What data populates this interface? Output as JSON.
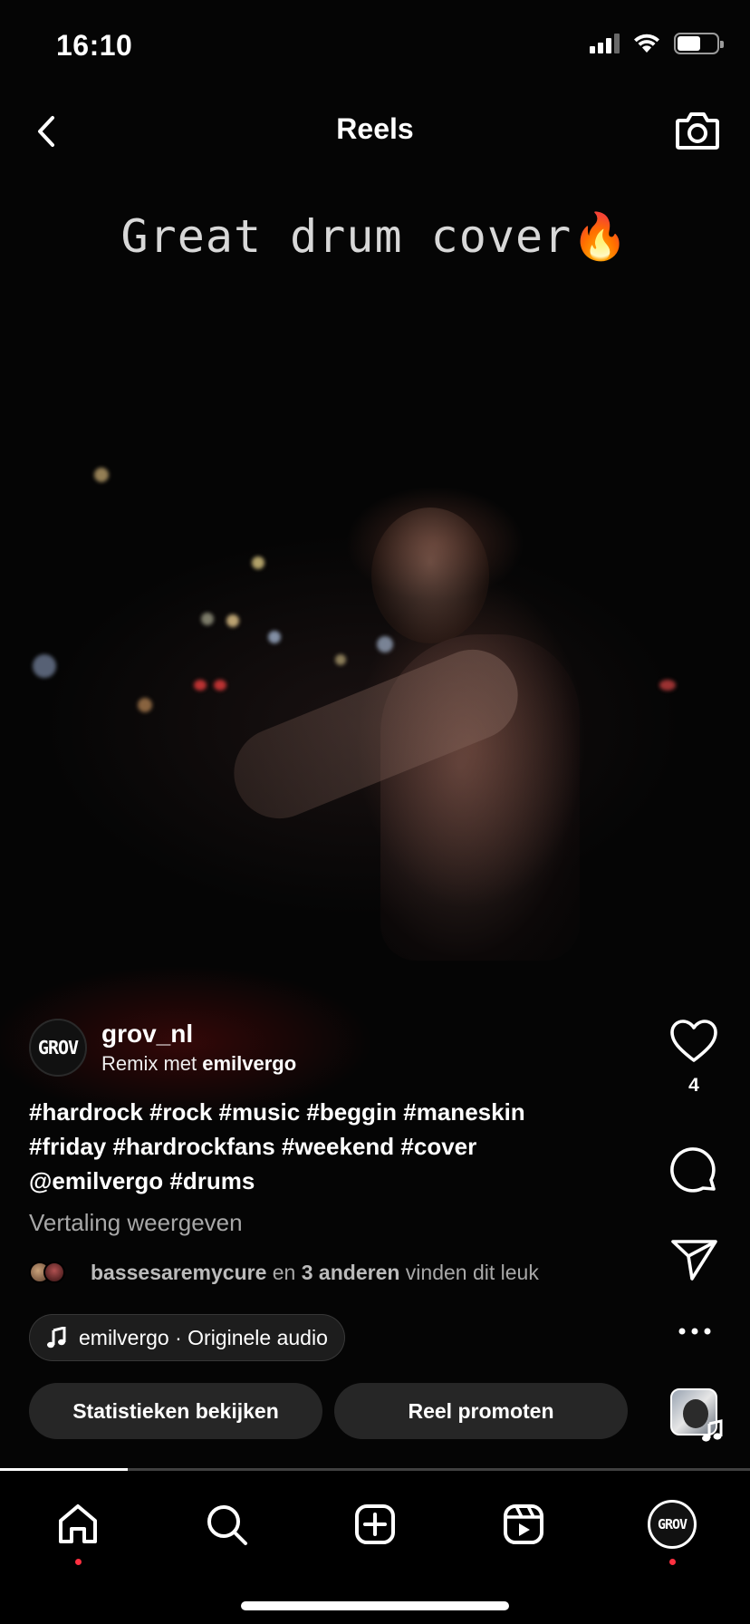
{
  "status_bar": {
    "time": "16:10",
    "battery_level": 0.6
  },
  "header": {
    "title": "Reels"
  },
  "video": {
    "overlay_text": "Great drum cover🔥"
  },
  "author": {
    "avatar_text": "GROV",
    "username": "grov_nl",
    "remix_prefix": "Remix met",
    "remix_user": "emilvergo"
  },
  "caption": "#hardrock #rock #music #beggin #maneskin #friday #hardrockfans #weekend #cover @emilvergo #drums",
  "translate_label": "Vertaling weergeven",
  "likes": {
    "first_user": "bassesaremycure",
    "joiner": "en",
    "others": "3 anderen",
    "suffix": "vinden dit leuk"
  },
  "audio": {
    "label": "emilvergo · Originele audio"
  },
  "actions": {
    "insights_label": "Statistieken bekijken",
    "promote_label": "Reel promoten"
  },
  "rail": {
    "like_count": "4"
  },
  "progress": {
    "fraction": 0.17
  },
  "tabs": [
    "home",
    "search",
    "create",
    "reels",
    "profile"
  ],
  "colors": {
    "notification_dot": "#ff3040",
    "background": "#000000"
  }
}
